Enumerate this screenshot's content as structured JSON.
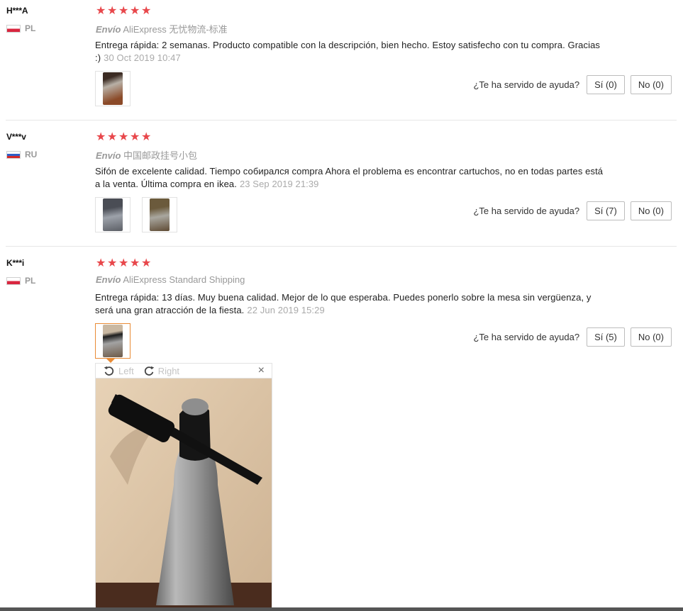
{
  "helpful_label": "¿Te ha servido de ayuda?",
  "colors": {
    "star": "#e8474b",
    "accent": "#e98b35",
    "muted": "#999999"
  },
  "reviews": [
    {
      "user": "H***A",
      "country": "PL",
      "stars": 5,
      "shipping_prefix": "Envío",
      "shipping_method": "AliExpress 无忧物流-标准",
      "text": "Entrega rápida: 2 semanas. Producto compatible con la descripción, bien hecho. Estoy satisfecho con tu compra. Gracias :)",
      "date": "30 Oct 2019 10:47",
      "yes": "Sí (0)",
      "no": "No (0)"
    },
    {
      "user": "V***v",
      "country": "RU",
      "stars": 5,
      "shipping_prefix": "Envío",
      "shipping_method": "中国邮政挂号小包",
      "text": "Sifón de excelente calidad. Tiempo собирался compra Ahora el problema es encontrar cartuchos, no en todas partes está a la venta. Última compra en ikea.",
      "date": "23 Sep 2019 21:39",
      "yes": "Sí (7)",
      "no": "No (0)"
    },
    {
      "user": "K***i",
      "country": "PL",
      "stars": 5,
      "shipping_prefix": "Envío",
      "shipping_method": "AliExpress Standard Shipping",
      "text": "Entrega rápida: 13 días. Muy buena calidad. Mejor de lo que esperaba. Puedes ponerlo sobre la mesa sin vergüenza, y será una gran atracción de la fiesta.",
      "date": "22 Jun 2019 15:29",
      "yes": "Sí (5)",
      "no": "No (0)"
    }
  ],
  "viewer": {
    "rotate_left": "Left",
    "rotate_right": "Right",
    "close": "×"
  }
}
